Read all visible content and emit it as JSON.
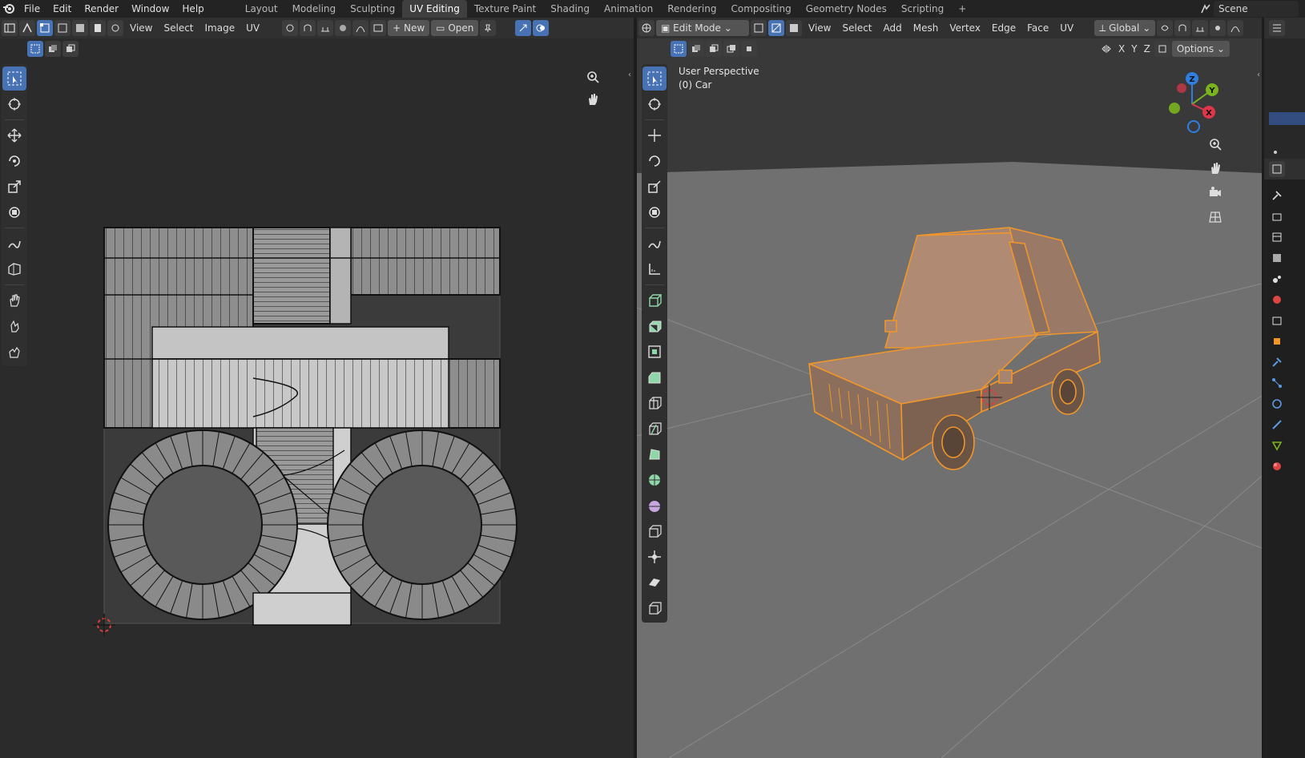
{
  "topbar": {
    "menus": [
      "File",
      "Edit",
      "Render",
      "Window",
      "Help"
    ],
    "workspaces": [
      "Layout",
      "Modeling",
      "Sculpting",
      "UV Editing",
      "Texture Paint",
      "Shading",
      "Animation",
      "Rendering",
      "Compositing",
      "Geometry Nodes",
      "Scripting"
    ],
    "active_workspace": "UV Editing",
    "add_tab": "+",
    "scene_name": "Scene"
  },
  "uv_editor": {
    "menus": [
      "View",
      "Select",
      "Image",
      "UV"
    ],
    "new_label": "New",
    "open_label": "Open"
  },
  "viewport": {
    "mode": "Edit Mode",
    "menus": [
      "View",
      "Select",
      "Add",
      "Mesh",
      "Vertex",
      "Edge",
      "Face",
      "UV"
    ],
    "orientation": "Global",
    "axes": [
      "X",
      "Y",
      "Z"
    ],
    "options_label": "Options",
    "perspective_label": "User Perspective",
    "object_label": "(0) Car",
    "gizmo": {
      "x": "X",
      "y": "Y",
      "z": "Z"
    }
  },
  "colors": {
    "accent": "#4772b3",
    "selection": "#f0962a",
    "gizmo_x": "#e0364a",
    "gizmo_y": "#7bb31e",
    "gizmo_z": "#2f7fe0"
  }
}
